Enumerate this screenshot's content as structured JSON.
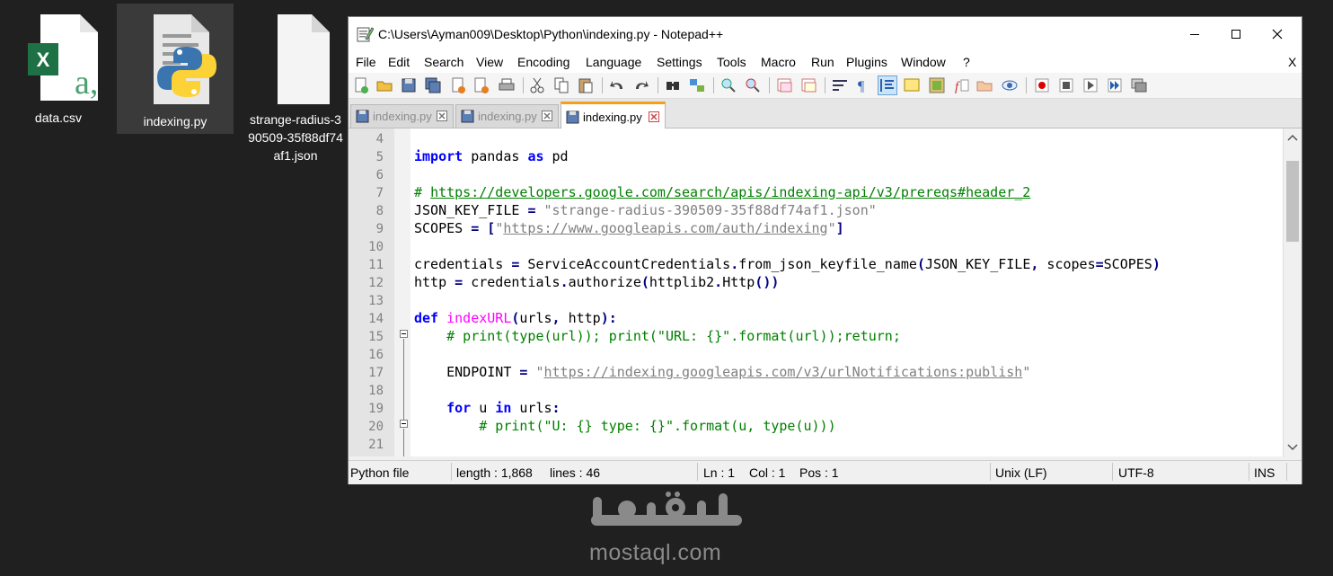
{
  "desktop": {
    "icons": [
      {
        "label": "data.csv",
        "icon": "excel-csv-icon"
      },
      {
        "label": "indexing.py",
        "icon": "python-file-icon",
        "selected": true
      },
      {
        "label_lines": [
          "strange-radius-3",
          "90509-35f88df74",
          "af1.json"
        ],
        "icon": "blank-file-icon"
      }
    ]
  },
  "window": {
    "title": "C:\\Users\\Ayman009\\Desktop\\Python\\indexing.py - Notepad++",
    "menu": [
      "File",
      "Edit",
      "Search",
      "View",
      "Encoding",
      "Language",
      "Settings",
      "Tools",
      "Macro",
      "Run",
      "Plugins",
      "Window",
      "?"
    ],
    "menu_close": "X",
    "tabs": [
      {
        "label": "indexing.py",
        "active": false
      },
      {
        "label": "indexing.py",
        "active": false
      },
      {
        "label": "indexing.py",
        "active": true
      }
    ]
  },
  "editor": {
    "line_numbers": [
      "4",
      "5",
      "6",
      "7",
      "8",
      "9",
      "10",
      "11",
      "12",
      "13",
      "14",
      "15",
      "16",
      "17",
      "18",
      "19",
      "20",
      "21"
    ]
  },
  "statusbar": {
    "file_type": "Python file",
    "length": "length : 1,868",
    "lines": "lines : 46",
    "ln": "Ln : 1",
    "col": "Col : 1",
    "pos": "Pos : 1",
    "eol": "Unix (LF)",
    "encoding": "UTF-8",
    "mode": "INS"
  },
  "watermark": {
    "text": "mostaql.com"
  },
  "colors": {
    "keyword": "#0000ff",
    "function_name": "#ff00ff",
    "comment": "#008000",
    "string": "#808080",
    "active_tab_accent": "#f6a01a"
  }
}
